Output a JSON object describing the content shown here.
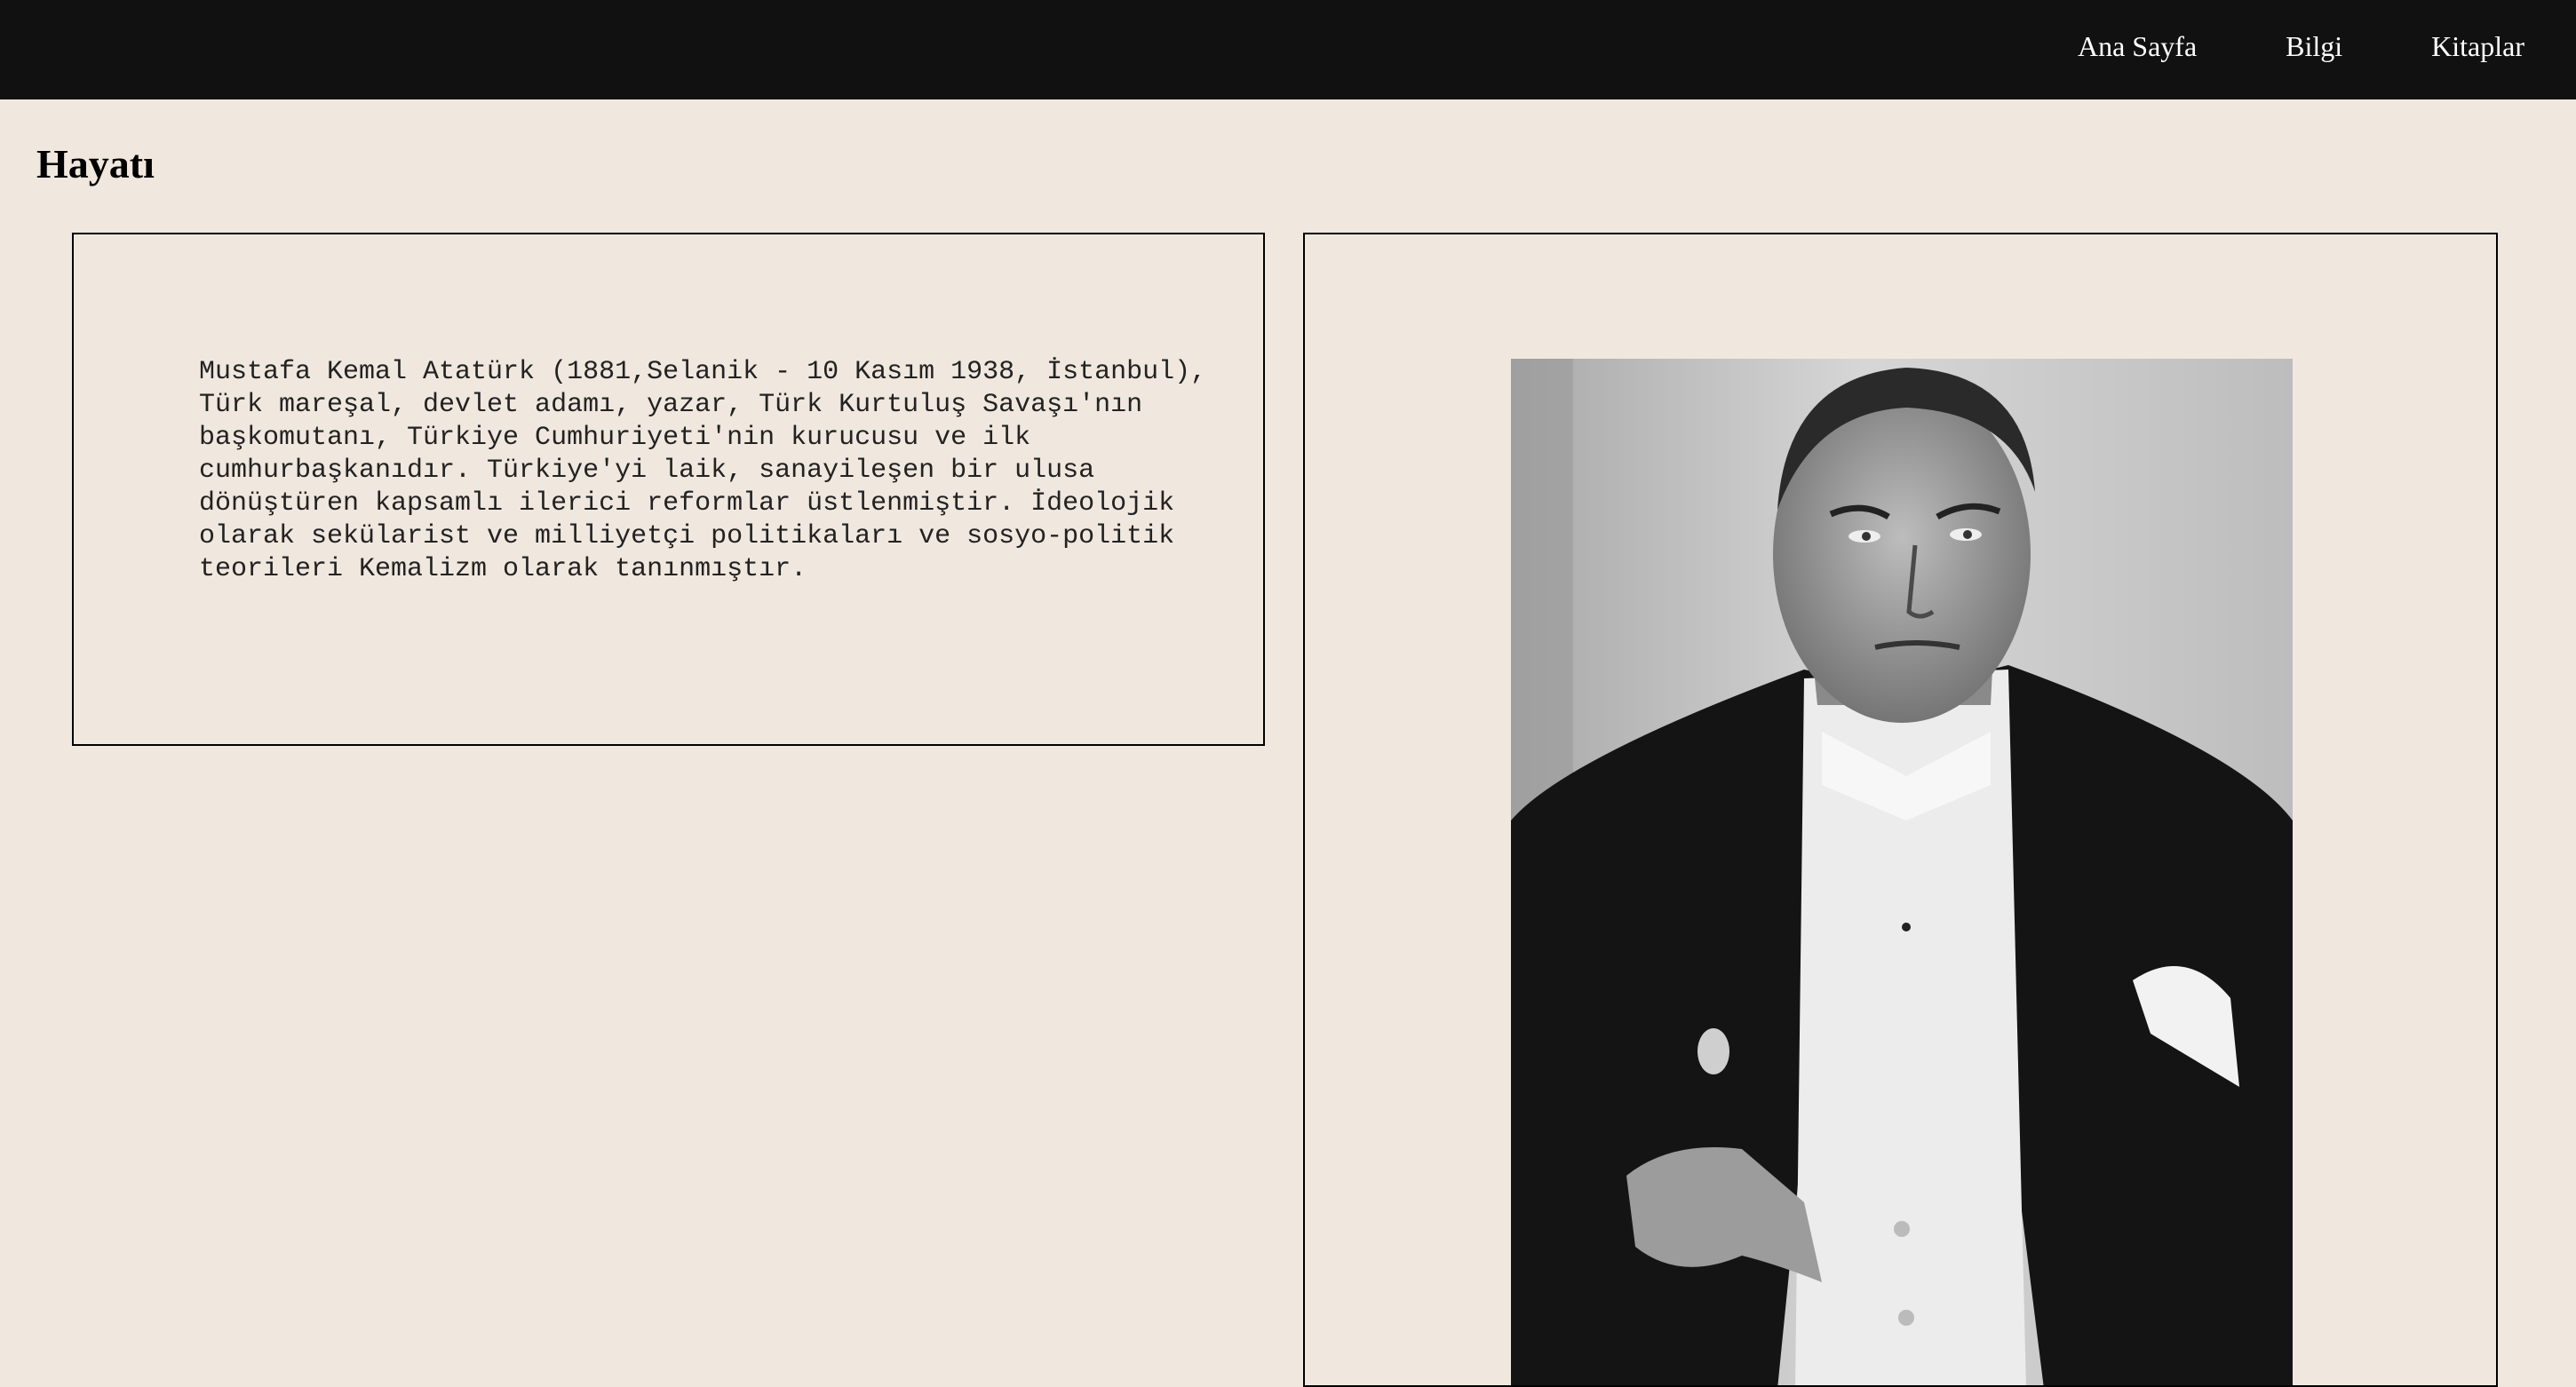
{
  "nav": {
    "items": [
      {
        "label": "Ana Sayfa"
      },
      {
        "label": "Bilgi"
      },
      {
        "label": "Kitaplar"
      }
    ]
  },
  "main": {
    "title": "Hayatı",
    "bio": "Mustafa Kemal Atatürk (1881,Selanik - 10 Kasım 1938, İstanbul), Türk mareşal, devlet adamı, yazar, Türk Kurtuluş Savaşı'nın başkomutanı, Türkiye Cumhuriyeti'nin kurucusu ve ilk cumhurbaşkanıdır. Türkiye'yi laik, sanayileşen bir ulusa dönüştüren kapsamlı ilerici reformlar üstlenmiştir. İdeolojik olarak sekülarist ve milliyetçi politikaları ve sosyo-politik teorileri Kemalizm olarak tanınmıştır."
  },
  "colors": {
    "background": "#f0e7de",
    "topbar": "#111111",
    "border": "#000000"
  }
}
